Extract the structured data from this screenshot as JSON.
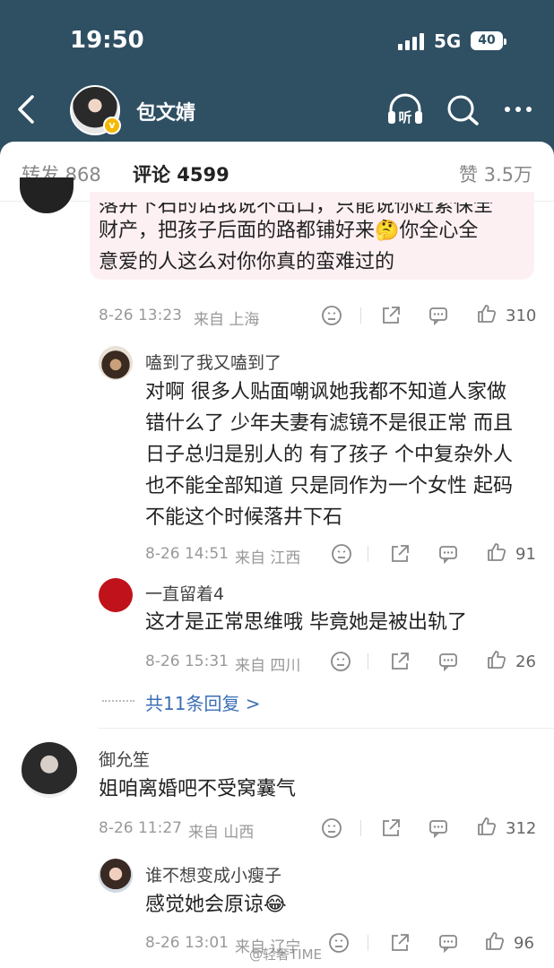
{
  "status_bar": {
    "time": "19:50",
    "network": "5G",
    "battery": "40"
  },
  "header": {
    "title": "包文婧",
    "verified_badge": "v",
    "icons": [
      "back-icon",
      "listen-icon",
      "search-icon",
      "more-icon"
    ],
    "listen_label": "听"
  },
  "tabs": {
    "repost": "转发 868",
    "comments": "评论 4599",
    "likes": "赞 3.5万"
  },
  "comments": [
    {
      "text_lines": [
        "落井下石的话我说不出口，只能说你赶紧保全",
        "财产，把孩子后面的路都铺好来🤔你全心全",
        "意爱的人这么对你你真的蛮难过的"
      ],
      "time": "8-26 13:23",
      "location": "来自 上海",
      "likes": "310",
      "replies": [
        {
          "user": "嗑到了我又嗑到了",
          "text_lines": [
            "对啊 很多人贴面嘲讽她我都不知道人家做",
            "错什么了 少年夫妻有滤镜不是很正常 而且",
            "日子总归是别人的 有了孩子 个中复杂外人",
            "也不能全部知道 只是同作为一个女性 起码",
            "不能这个时候落井下石"
          ],
          "time": "8-26 14:51",
          "location": "来自 江西",
          "likes": "91"
        },
        {
          "user": "一直留着4",
          "text_lines": [
            "这才是正常思维哦  毕竟她是被出轨了"
          ],
          "time": "8-26 15:31",
          "location": "来自 四川",
          "likes": "26"
        }
      ],
      "more_replies": "共11条回复 >"
    },
    {
      "user": "御允笙",
      "text_lines": [
        "姐咱离婚吧不受窝囊气"
      ],
      "time": "8-26 11:27",
      "location": "来自 山西",
      "likes": "312",
      "replies": [
        {
          "user": "谁不想变成小瘦子",
          "text_lines": [
            "感觉她会原谅😂"
          ],
          "time": "8-26 13:01",
          "location": "来自 辽宁",
          "likes": "96"
        }
      ]
    }
  ],
  "watermark": "@轻奢TIME",
  "colors": {
    "header_bg": "#2f4f63",
    "accent": "#ff8200",
    "link": "#3b6fb6",
    "highlight_bg": "#fdf0f3"
  }
}
